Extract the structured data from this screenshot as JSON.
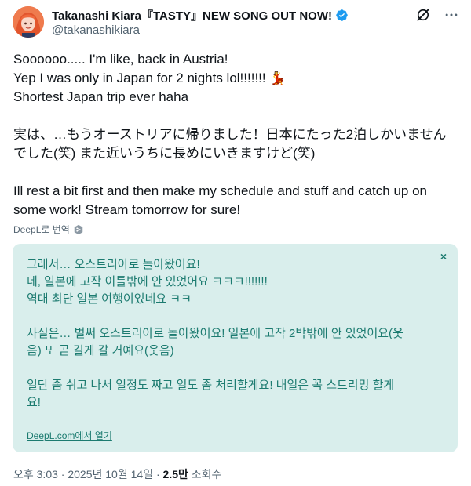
{
  "user": {
    "display_name": "Takanashi Kiara『TASTY』NEW SONG OUT NOW!",
    "handle": "@takanashikiara",
    "verified": true,
    "avatar_icon": "avatar-image"
  },
  "actions": {
    "grok_icon": "grok-icon",
    "more_icon": "more-icon"
  },
  "tweet": {
    "line1": "Soooooo..... I'm like, back in Austria!",
    "line2": "Yep I was only in Japan for 2 nights lol!!!!!!! 💃",
    "line3": "Shortest Japan trip ever haha",
    "line4": "実は、…もうオーストリアに帰りました！日本にたった2泊しかいません",
    "line5": "でした(笑) また近いうちに長めにいきますけど(笑)",
    "line6": "Ill rest a bit first and then make my schedule and stuff and catch up on",
    "line7": "some work! Stream tomorrow for sure!"
  },
  "translate": {
    "label": "DeepL로 번역"
  },
  "translation": {
    "line1": "그래서… 오스트리아로 돌아왔어요!",
    "line2": "네, 일본에 고작 이틀밖에 안 있었어요 ㅋㅋㅋ!!!!!!!",
    "line3": "역대 최단 일본 여행이었네요 ㅋㅋ",
    "line4": "사실은… 벌써 오스트리아로 돌아왔어요! 일본에 고작 2박밖에 안 있었어요(웃",
    "line5": "음) 또 곧 길게 갈 거예요(웃음)",
    "line6": "일단 좀 쉬고 나서 일정도 짜고 일도 좀 처리할게요! 내일은 꼭 스트리밍 할게",
    "line7": "요!",
    "close_label": "×",
    "open_link": "DeepL.com에서 열기",
    "accent_color": "#1c7b70",
    "bg_color": "#d9eeec"
  },
  "meta": {
    "time": "오후 3:03",
    "date": "2025년 10월 14일",
    "views": "2.5만",
    "views_label": "조회수",
    "separator": "·"
  }
}
